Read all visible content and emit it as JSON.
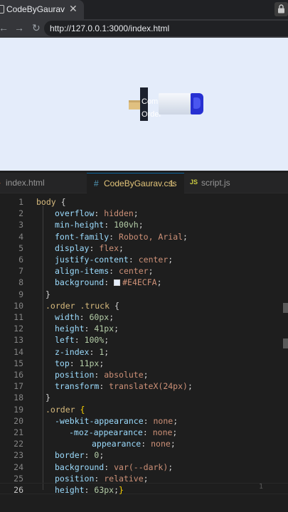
{
  "browser": {
    "tab_title": "CodeByGaurav",
    "url": "http://127.0.0.1:3000/index.html",
    "icons": [
      "back-arrow-icon",
      "forward-arrow-icon",
      "reload-icon",
      "close-icon",
      "lock-icon"
    ]
  },
  "preview": {
    "background": "#E4ECFA",
    "button_line1": "Com",
    "button_line2": "Order"
  },
  "editor": {
    "tabs": [
      {
        "label": "index.html",
        "icon": "html-file-icon"
      },
      {
        "label": "CodeByGaurav.css",
        "badge": "1",
        "icon": "css-hash-icon"
      },
      {
        "label": "script.js",
        "icon": "js-file-icon"
      }
    ],
    "active_tab": 1,
    "current_line": 26,
    "ghost_hint": "1",
    "lines": [
      {
        "n": "1",
        "s": "body",
        "p": "",
        "v": " {"
      },
      {
        "n": "2",
        "s": "",
        "p": "overflow",
        "v": "hidden"
      },
      {
        "n": "3",
        "s": "",
        "p": "min-height",
        "v": "100vh"
      },
      {
        "n": "4",
        "s": "",
        "p": "font-family",
        "v": "Roboto, Arial"
      },
      {
        "n": "5",
        "s": "",
        "p": "display",
        "v": "flex"
      },
      {
        "n": "6",
        "s": "",
        "p": "justify-content",
        "v": "center"
      },
      {
        "n": "7",
        "s": "",
        "p": "align-items",
        "v": "center"
      },
      {
        "n": "8",
        "s": "",
        "p": "background",
        "v": "#E4ECFA"
      },
      {
        "n": "9",
        "s": "",
        "p": "",
        "v": "}"
      },
      {
        "n": "10",
        "s": ".order .truck",
        "p": "",
        "v": " {"
      },
      {
        "n": "11",
        "s": "",
        "p": "width",
        "v": "60px"
      },
      {
        "n": "12",
        "s": "",
        "p": "height",
        "v": "41px"
      },
      {
        "n": "13",
        "s": "",
        "p": "left",
        "v": "100%"
      },
      {
        "n": "14",
        "s": "",
        "p": "z-index",
        "v": "1"
      },
      {
        "n": "15",
        "s": "",
        "p": "top",
        "v": "11px"
      },
      {
        "n": "16",
        "s": "",
        "p": "position",
        "v": "absolute"
      },
      {
        "n": "17",
        "s": "",
        "p": "transform",
        "v": "translateX(24px)"
      },
      {
        "n": "18",
        "s": "",
        "p": "",
        "v": "}"
      },
      {
        "n": "19",
        "s": ".order",
        "p": "",
        "v": " {"
      },
      {
        "n": "20",
        "s": "",
        "p": "-webkit-appearance",
        "v": "none"
      },
      {
        "n": "21",
        "s": "",
        "p": "-moz-appearance",
        "v": "none"
      },
      {
        "n": "22",
        "s": "",
        "p": "appearance",
        "v": "none"
      },
      {
        "n": "23",
        "s": "",
        "p": "border",
        "v": "0"
      },
      {
        "n": "24",
        "s": "",
        "p": "background",
        "v": "var(--dark)"
      },
      {
        "n": "25",
        "s": "",
        "p": "position",
        "v": "relative"
      },
      {
        "n": "26",
        "s": "",
        "p": "height",
        "v": "63px"
      }
    ]
  }
}
